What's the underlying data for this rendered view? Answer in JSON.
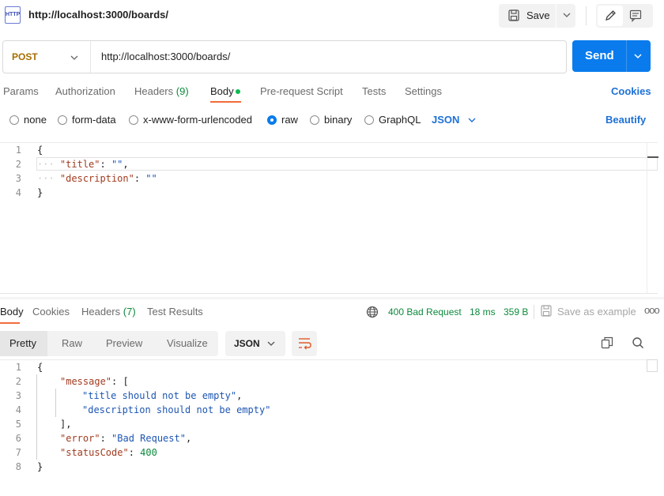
{
  "request": {
    "title": "http://localhost:3000/boards/",
    "icon_label": "HTTP",
    "save_label": "Save",
    "method": "POST",
    "url": "http://localhost:3000/boards/",
    "send_label": "Send"
  },
  "request_tabs": {
    "params": "Params",
    "authorization": "Authorization",
    "headers": "Headers",
    "headers_count": "(9)",
    "body": "Body",
    "pre_request": "Pre-request Script",
    "tests": "Tests",
    "settings": "Settings",
    "cookies": "Cookies"
  },
  "body_types": {
    "none": "none",
    "form_data": "form-data",
    "urlencoded": "x-www-form-urlencoded",
    "raw": "raw",
    "binary": "binary",
    "graphql": "GraphQL",
    "selected": "raw",
    "format": "JSON",
    "beautify": "Beautify"
  },
  "request_body": {
    "line_numbers": [
      "1",
      "2",
      "3",
      "4"
    ],
    "open_brace": "{",
    "title_key": "\"title\"",
    "title_value": "\"\"",
    "description_key": "\"description\"",
    "description_value": "\"\"",
    "close_brace": "}"
  },
  "response_tabs": {
    "body": "Body",
    "cookies": "Cookies",
    "headers": "Headers",
    "headers_count": "(7)",
    "test_results": "Test Results"
  },
  "response_meta": {
    "status": "400 Bad Request",
    "time": "18 ms",
    "size": "359 B",
    "save_example": "Save as example",
    "more": "ooo"
  },
  "view_tabs": {
    "pretty": "Pretty",
    "raw": "Raw",
    "preview": "Preview",
    "visualize": "Visualize",
    "format": "JSON"
  },
  "response_body": {
    "line_numbers": [
      "1",
      "2",
      "3",
      "4",
      "5",
      "6",
      "7",
      "8"
    ],
    "open_brace": "{",
    "message_key": "\"message\"",
    "open_bracket": "[",
    "msg1": "\"title should not be empty\"",
    "msg2": "\"description should not be empty\"",
    "close_bracket": "],",
    "error_key": "\"error\"",
    "error_value": "\"Bad Request\"",
    "status_key": "\"statusCode\"",
    "status_value": "400",
    "close_brace": "}"
  },
  "colors": {
    "accent": "#097bed",
    "tab_underline": "#f26b3a",
    "status_ok_text": "#0c8a3d",
    "method_post": "#a66d00"
  }
}
